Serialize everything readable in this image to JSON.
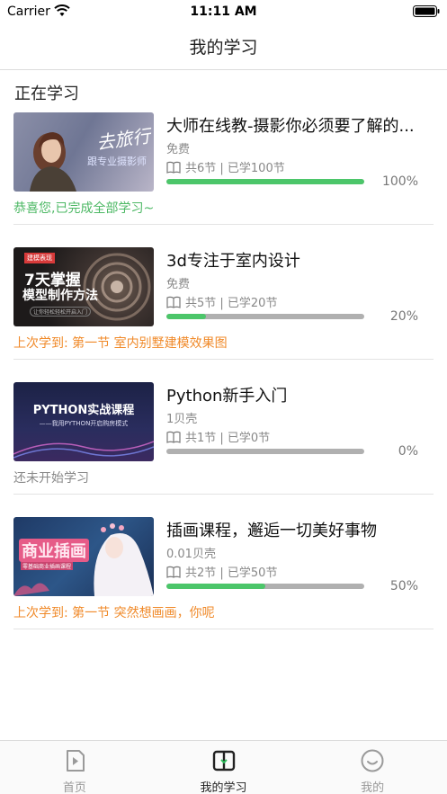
{
  "status_bar": {
    "carrier": "Carrier",
    "time": "11:11 AM"
  },
  "nav": {
    "title": "我的学习"
  },
  "section": {
    "title": "正在学习"
  },
  "colors": {
    "progress_done": "#4cc66a",
    "progress_track": "#b0b0b0",
    "note_green": "#4cb864",
    "note_orange": "#f08a2a"
  },
  "courses": [
    {
      "title": "大师在线教-摄影你必须要了解的...",
      "price": "免费",
      "stats": "共6节 | 已学100节",
      "progress_label": "100%",
      "progress": 1.0,
      "note": "恭喜您,已完成全部学习~",
      "note_tone": "green",
      "thumb_text": "去旅行",
      "thumb_sub": "跟专业摄影师"
    },
    {
      "title": "3d专注于室内设计",
      "price": "免费",
      "stats": "共5节 | 已学20节",
      "progress_label": "20%",
      "progress": 0.2,
      "note": "上次学到: 第一节 室内别墅建模效果图",
      "note_tone": "orange",
      "thumb_tag": "建模表现",
      "thumb_text": "7天掌握",
      "thumb_sub": "模型制作方法",
      "thumb_small": "让你轻松轻松开启入门"
    },
    {
      "title": "Python新手入门",
      "price": "1贝壳",
      "stats": "共1节 | 已学0节",
      "progress_label": "0%",
      "progress": 0.0,
      "note": "还未开始学习",
      "note_tone": "gray",
      "thumb_text": "PYTHON实战课程",
      "thumb_sub": "——我用PYTHON开启购房模式"
    },
    {
      "title": "插画课程，邂逅一切美好事物",
      "price": "0.01贝壳",
      "stats": "共2节 | 已学50节",
      "progress_label": "50%",
      "progress": 0.5,
      "note": "上次学到: 第一节 突然想画画，你呢",
      "note_tone": "orange",
      "thumb_text": "商业插画",
      "thumb_sub": "零基础商业插画课程"
    }
  ],
  "tabs": [
    {
      "label": "首页",
      "icon": "play-icon",
      "active": false
    },
    {
      "label": "我的学习",
      "icon": "book-icon",
      "active": true
    },
    {
      "label": "我的",
      "icon": "smile-icon",
      "active": false
    }
  ]
}
